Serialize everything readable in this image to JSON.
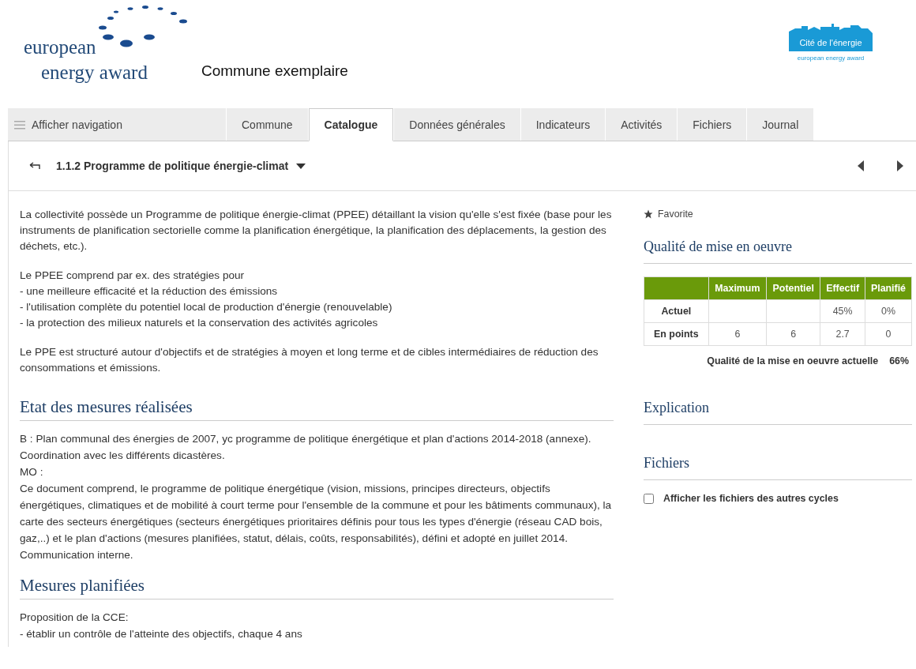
{
  "header": {
    "logo_left": {
      "line1": "european",
      "line2": "energy award"
    },
    "title": "Commune exemplaire",
    "logo_right": {
      "name": "Cité de l'énergie",
      "tagline": "european energy award"
    }
  },
  "nav_toggle": {
    "label": "Afficher navigation"
  },
  "tabs": [
    {
      "label": "Commune",
      "selected": false
    },
    {
      "label": "Catalogue",
      "selected": true
    },
    {
      "label": "Données générales",
      "selected": false
    },
    {
      "label": "Indicateurs",
      "selected": false
    },
    {
      "label": "Activités",
      "selected": false
    },
    {
      "label": "Fichiers",
      "selected": false
    },
    {
      "label": "Journal",
      "selected": false
    }
  ],
  "measure": {
    "title": "1.1.2 Programme de politique énergie-climat"
  },
  "intro": [
    {
      "lines": [
        "La collectivité possède un Programme de politique énergie-climat (PPEE) détaillant la vision qu'elle s'est fixée (base pour les instruments de planification sectorielle comme la planification énergétique, la planification des déplacements, la gestion des déchets, etc.)."
      ]
    },
    {
      "lines": [
        "Le PPEE comprend par ex. des stratégies pour",
        "- une meilleure efficacité et la réduction des émissions",
        "- l'utilisation complète du potentiel local de production d'énergie (renouvelable)",
        "- la protection des milieux naturels et la conservation des activités agricoles"
      ]
    },
    {
      "lines": [
        "Le PPE est structuré autour d'objectifs et de stratégies à moyen et long terme et de cibles intermédiaires de réduction des consommations et émissions."
      ]
    }
  ],
  "sections": [
    {
      "title": "Etat des mesures réalisées",
      "lines": [
        "B : Plan communal des énergies de 2007, yc programme de politique énergétique et plan d'actions 2014-2018 (annexe).",
        "Coordination avec les différents dicastères.",
        "MO :",
        "Ce document comprend, le programme de politique énergétique (vision, missions, principes directeurs, objectifs énergétiques, climatiques et de mobilité à court terme pour l'ensemble de la commune et pour les bâtiments communaux), la carte des secteurs énergétiques (secteurs énergétiques prioritaires définis pour tous les types d'énergie (réseau CAD bois, gaz,..) et le plan d'actions (mesures planifiées, statut, délais, coûts, responsabilités), défini et adopté en juillet 2014. Communication interne."
      ]
    },
    {
      "title": "Mesures planifiées",
      "lines": [
        "Proposition de la CCE:",
        "- établir un contrôle de l'atteinte des objectifs, chaque 4 ans"
      ]
    }
  ],
  "sidebar": {
    "favorite": {
      "label": "Favorite"
    },
    "quality": {
      "title": "Qualité de mise en oeuvre",
      "columns": [
        "Maximum",
        "Potentiel",
        "Effectif",
        "Planifié"
      ],
      "rows": [
        {
          "label": "Actuel",
          "cells": [
            null,
            null,
            "45%",
            "0%"
          ]
        },
        {
          "label": "En points",
          "cells": [
            "6",
            "6",
            "2.7",
            "0"
          ]
        }
      ],
      "summary_label": "Qualité de la mise en oeuvre actuelle",
      "summary_value": "66%"
    },
    "explanation": {
      "title": "Explication"
    },
    "files": {
      "title": "Fichiers",
      "option": {
        "label": "Afficher les fichiers des autres cycles",
        "checked": false
      }
    }
  }
}
